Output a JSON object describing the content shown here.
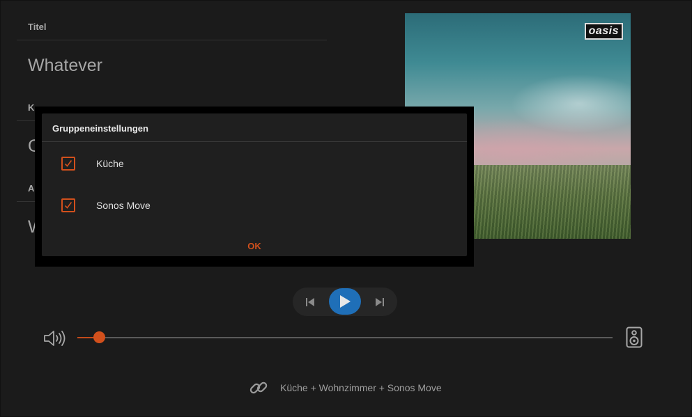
{
  "info": {
    "fields": [
      {
        "label": "Titel",
        "value": "Whatever"
      },
      {
        "label": "K",
        "value": "O"
      },
      {
        "label": "A",
        "value": "W"
      }
    ]
  },
  "cover": {
    "logo_text": "oasis"
  },
  "transport": {
    "prev_icon": "skip-previous-icon",
    "play_icon": "play-icon",
    "next_icon": "skip-next-icon",
    "play_color": "#1f6fb8"
  },
  "volume": {
    "level": 0.04,
    "accent": "#d2501c"
  },
  "group": {
    "text": "Küche + Wohnzimmer + Sonos Move",
    "icon": "link-icon"
  },
  "dialog": {
    "title": "Gruppeneinstellungen",
    "items": [
      {
        "label": "Küche",
        "checked": true
      },
      {
        "label": "Sonos Move",
        "checked": true
      }
    ],
    "ok_label": "OK"
  }
}
